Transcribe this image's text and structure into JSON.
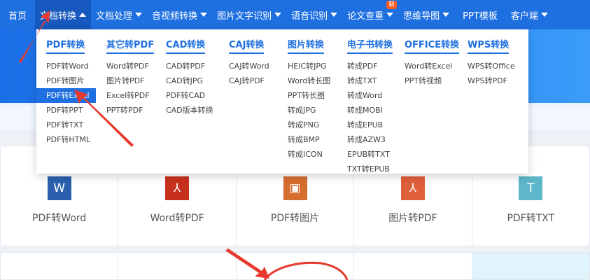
{
  "nav": {
    "items": [
      {
        "label": "首页",
        "caret": false
      },
      {
        "label": "文档转换",
        "caret": "up",
        "active": true
      },
      {
        "label": "文档处理",
        "caret": "down"
      },
      {
        "label": "音视频转换",
        "caret": "down"
      },
      {
        "label": "图片文字识别",
        "caret": "down"
      },
      {
        "label": "语音识别",
        "caret": "down"
      },
      {
        "label": "论文查重",
        "caret": "down",
        "badge": "新"
      },
      {
        "label": "思维导图",
        "caret": "down"
      },
      {
        "label": "PPT模板",
        "caret": false
      },
      {
        "label": "客户端",
        "caret": "down"
      }
    ]
  },
  "dropdown": {
    "columns": [
      {
        "title": "PDF转换",
        "items": [
          "PDF转Word",
          "PDF转图片",
          "PDF转Excel",
          "PDF转PPT",
          "PDF转TXT",
          "PDF转HTML"
        ],
        "selected": 2
      },
      {
        "title": "其它转PDF",
        "items": [
          "Word转PDF",
          "图片转PDF",
          "Excel转PDF",
          "PPT转PDF"
        ]
      },
      {
        "title": "CAD转换",
        "items": [
          "CAD转PDF",
          "CAD转JPG",
          "PDF转CAD",
          "CAD版本转换"
        ]
      },
      {
        "title": "CAJ转换",
        "items": [
          "CAJ转Word",
          "CAJ转PDF"
        ]
      },
      {
        "title": "图片转换",
        "items": [
          "HEIC转JPG",
          "Word转长图",
          "PPT转长图",
          "转成JPG",
          "转成PNG",
          "转成BMP",
          "转成ICON"
        ]
      },
      {
        "title": "电子书转换",
        "items": [
          "转成PDF",
          "转成TXT",
          "转成Word",
          "转成MOBI",
          "转成EPUB",
          "转成AZW3",
          "EPUB转TXT",
          "TXT转EPUB"
        ]
      },
      {
        "title": "OFFICE转换",
        "items": [
          "Word转Excel",
          "PPT转视频"
        ]
      },
      {
        "title": "WPS转换",
        "items": [
          "WPS转Office",
          "WPS转PDF"
        ]
      }
    ]
  },
  "tools": [
    {
      "label": "PDF转Word",
      "icon": "word-icon",
      "glyph": "W",
      "color": "#2b5fae"
    },
    {
      "label": "Word转PDF",
      "icon": "pdf-icon",
      "glyph": "⅄",
      "color": "#c8301e"
    },
    {
      "label": "PDF转图片",
      "icon": "image-icon",
      "glyph": "▣",
      "color": "#d66e2e"
    },
    {
      "label": "图片转PDF",
      "icon": "pdf-icon",
      "glyph": "⅄",
      "color": "#e05f3c"
    },
    {
      "label": "PDF转TXT",
      "icon": "text-icon",
      "glyph": "T",
      "color": "#5db6c9"
    }
  ],
  "colors": {
    "brand": "#1e6fe0",
    "annotation": "#e83a2e"
  }
}
